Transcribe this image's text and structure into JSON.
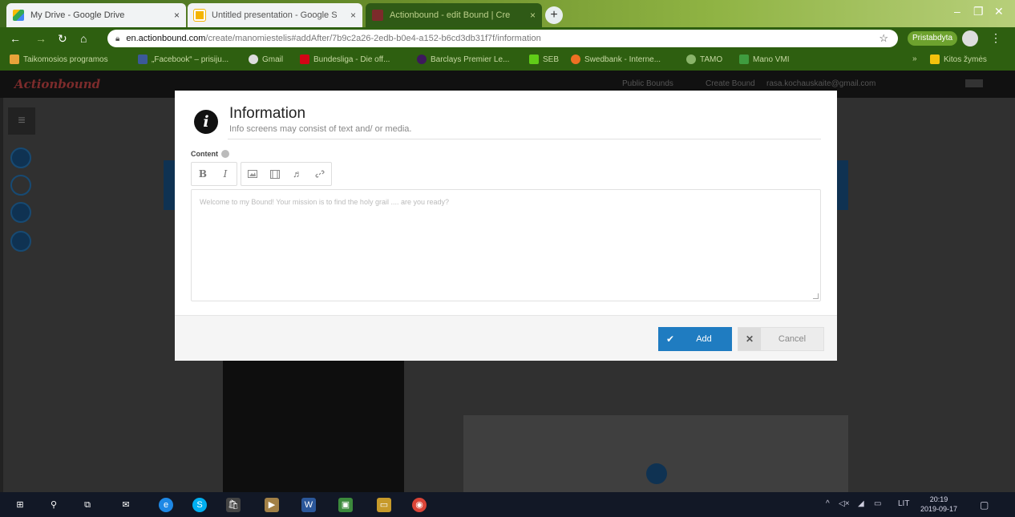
{
  "browser": {
    "tabs": [
      {
        "title": "My Drive - Google Drive",
        "close": "×"
      },
      {
        "title": "Untitled presentation - Google S",
        "close": "×"
      },
      {
        "title": "Actionbound - edit Bound | Cre",
        "close": "×"
      }
    ],
    "new_tab": "+",
    "address": {
      "domain": "en.actionbound.com",
      "path": "/create/manomiestelis#addAfter/7b9c2a26-2edb-b0e4-a152-b6cd3db31f7f/information"
    },
    "profile_label": "Pristabdyta",
    "bookmarks": [
      "Taikomosios programos",
      "„Facebook“ – prisiju...",
      "Gmail",
      "Bundesliga - Die off...",
      "Barclays Premier Le...",
      "SEB",
      "Swedbank - Interne...",
      "TAMO",
      "Mano VMI"
    ],
    "other_bookmarks": "Kitos žymės"
  },
  "app": {
    "brand": "Actionbound",
    "nav": [
      "Public Bounds",
      "Create Bound"
    ],
    "user_email": "rasa.kochauskaite@gmail.com"
  },
  "modal": {
    "title": "Information",
    "subtitle": "Info screens may consist of text and/ or media.",
    "content_label": "Content",
    "toolbar": {
      "bold": "B",
      "italic": "I"
    },
    "editor_placeholder": "Welcome to my Bound! Your mission is to find the holy grail .... are you ready?",
    "add_label": "Add",
    "cancel_label": "Cancel"
  },
  "taskbar": {
    "lang": "LIT",
    "time": "20:19",
    "date": "2019-09-17"
  },
  "colors": {
    "primary_button": "#1f7cc1",
    "brand_red": "#7c2b2b"
  }
}
